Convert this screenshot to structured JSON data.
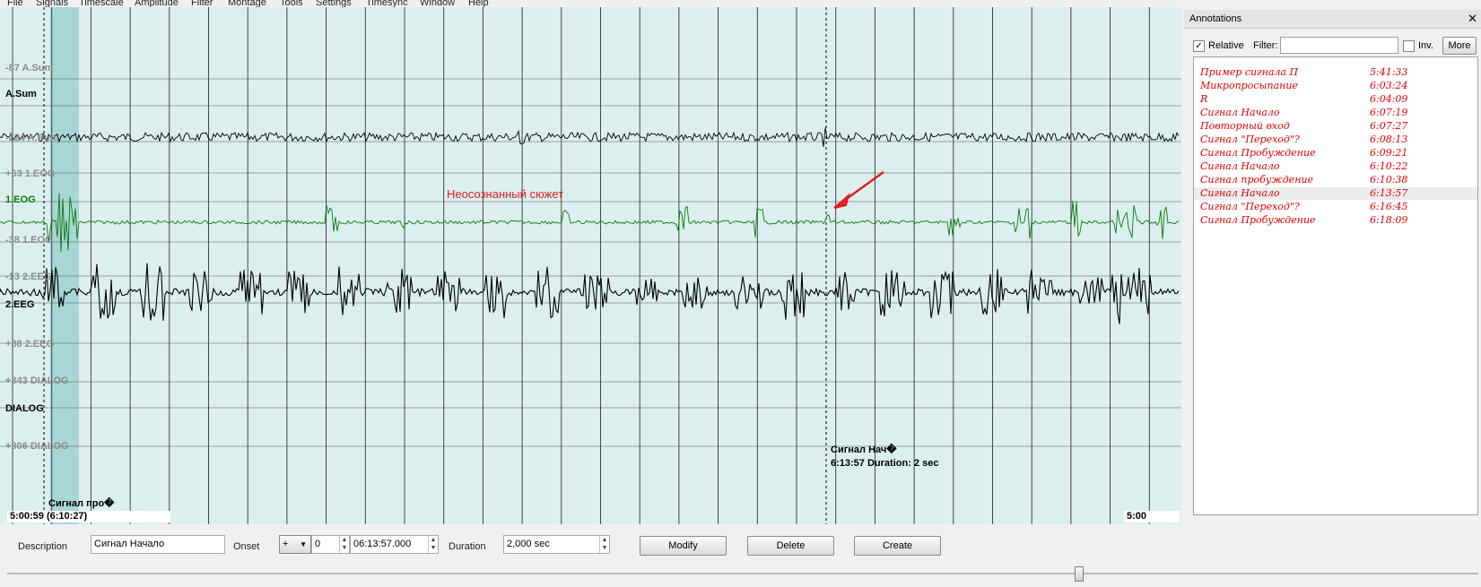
{
  "menu": [
    "File",
    "Signals",
    "Timescale",
    "Amplitude",
    "Filter",
    "Montage",
    "Tools",
    "Settings",
    "Timesync",
    "Window",
    "Help"
  ],
  "channels": [
    {
      "top_label": "-87 A.Sum",
      "name": "A.Sum",
      "bottom_label": "-224 A.Sum",
      "color": "#000000"
    },
    {
      "top_label": "+63 1.EOG",
      "name": "1.EOG",
      "bottom_label": "-38 1.EOG",
      "color": "#0a7a0a"
    },
    {
      "top_label": "-13 2.EEG",
      "name": "2.EEG",
      "bottom_label": "+88 2.EEG",
      "color": "#000000"
    },
    {
      "top_label": "+843 DIALOG",
      "name": "DIALOG",
      "bottom_label": "+806 DIALOG",
      "color": "#000000"
    }
  ],
  "viewer": {
    "start_time": "5:00:59 (6:10:27)",
    "end_time": "5:00",
    "left_annotation": "Сигнал про�",
    "marker_annotation_line1": "Сигнал Нач�",
    "marker_annotation_line2": "6:13:57 Duration: 2 sec",
    "overlay_note": "Неосознанный сюжет"
  },
  "annotations_panel": {
    "title": "Annotations",
    "close_glyph": "✕",
    "relative_label": "Relative",
    "relative_checked": true,
    "filter_label": "Filter:",
    "filter_value": "",
    "inv_label": "Inv.",
    "inv_checked": false,
    "more_label": "More",
    "items": [
      {
        "desc": "Пример сигнала П",
        "time": "5:41:33"
      },
      {
        "desc": "Микропросыпание",
        "time": "6:03:24"
      },
      {
        "desc": "R",
        "time": "6:04:09"
      },
      {
        "desc": "Сигнал Начало",
        "time": "6:07:19"
      },
      {
        "desc": "Повторный вход",
        "time": "6:07:27"
      },
      {
        "desc": "Сигнал \"Переход\"?",
        "time": "6:08:13"
      },
      {
        "desc": "Сигнал Пробуждение",
        "time": "6:09:21"
      },
      {
        "desc": "Сигнал Начало",
        "time": "6:10:22"
      },
      {
        "desc": "Сигнал пробуждение",
        "time": "6:10:38"
      },
      {
        "desc": "Сигнал Начало",
        "time": "6:13:57",
        "selected": true
      },
      {
        "desc": "Сигнал \"Переход\"?",
        "time": "6:16:45"
      },
      {
        "desc": "Сигнал Пробуждение",
        "time": "6:18:09"
      }
    ]
  },
  "editor": {
    "description_label": "Description",
    "description_value": "Сигнал Начало",
    "onset_label": "Onset",
    "onset_sign": "+",
    "onset_days": "0",
    "onset_time": "06:13:57.000",
    "duration_label": "Duration",
    "duration_value": "2,000 sec",
    "modify_label": "Modify",
    "delete_label": "Delete",
    "create_label": "Create"
  },
  "colors": {
    "eog": "#0a7a0a",
    "annotation_text": "#e00000",
    "arrow": "#e02020",
    "viewer_bg": "#dcefef",
    "shade": "#a8d6d6"
  }
}
